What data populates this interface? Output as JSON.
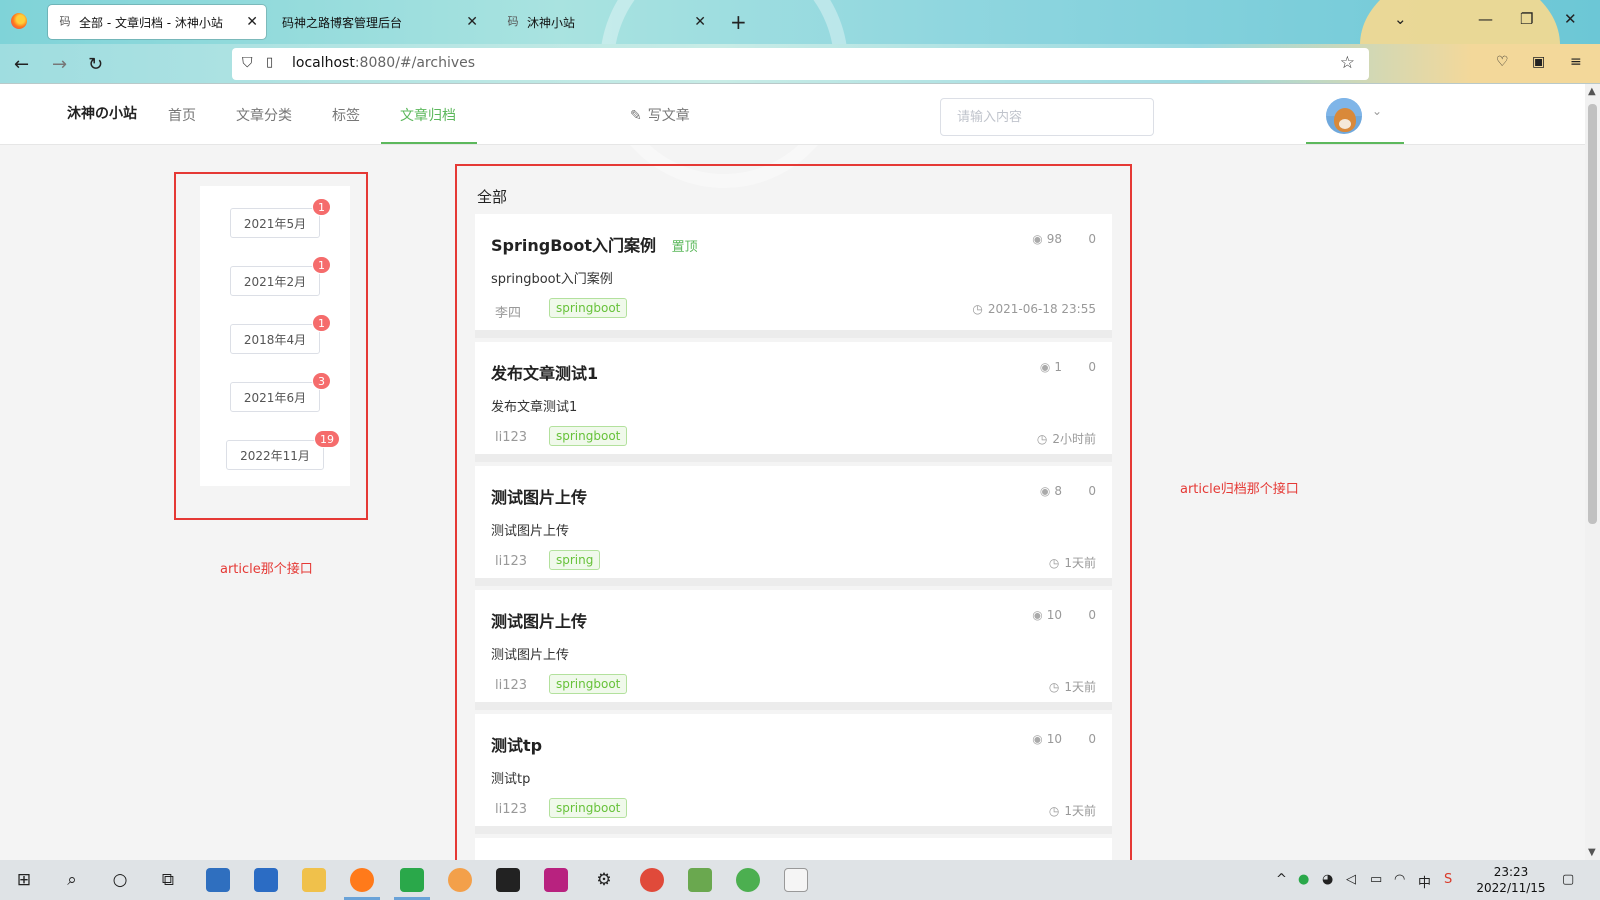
{
  "browser": {
    "tabs": [
      {
        "label": "全部 - 文章归档 - 沐神小站",
        "icon": "码"
      },
      {
        "label": "码神之路博客管理后台",
        "icon": ""
      },
      {
        "label": "沐神小站",
        "icon": "码"
      }
    ],
    "url_host": "localhost",
    "url_rest": ":8080/#/archives"
  },
  "header": {
    "logo": "沐神の小站",
    "nav": [
      "首页",
      "文章分类",
      "标签",
      "文章归档"
    ],
    "active_nav": "文章归档",
    "write_label": "写文章",
    "search_placeholder": "请输入内容",
    "accent_color": "#5cb85c"
  },
  "archives": {
    "items": [
      {
        "label": "2021年5月",
        "count": "1"
      },
      {
        "label": "2021年2月",
        "count": "1"
      },
      {
        "label": "2018年4月",
        "count": "1"
      },
      {
        "label": "2021年6月",
        "count": "3"
      },
      {
        "label": "2022年11月",
        "count": "19"
      }
    ],
    "note": "article那个接口"
  },
  "main": {
    "section_title": "全部",
    "note": "article归档那个接口",
    "articles": [
      {
        "title": "SpringBoot入门案例",
        "top_label": "置顶",
        "views": "98",
        "comments": "0",
        "summary": "springboot入门案例",
        "author": "李四",
        "tag": "springboot",
        "time": "2021-06-18 23:55"
      },
      {
        "title": "发布文章测试1",
        "top_label": "",
        "views": "1",
        "comments": "0",
        "summary": "发布文章测试1",
        "author": "li123",
        "tag": "springboot",
        "time": "2小时前"
      },
      {
        "title": "测试图片上传",
        "top_label": "",
        "views": "8",
        "comments": "0",
        "summary": "测试图片上传",
        "author": "li123",
        "tag": "spring",
        "time": "1天前"
      },
      {
        "title": "测试图片上传",
        "top_label": "",
        "views": "10",
        "comments": "0",
        "summary": "测试图片上传",
        "author": "li123",
        "tag": "springboot",
        "time": "1天前"
      },
      {
        "title": "测试tp",
        "top_label": "",
        "views": "10",
        "comments": "0",
        "summary": "测试tp",
        "author": "li123",
        "tag": "springboot",
        "time": "1天前"
      }
    ]
  },
  "taskbar": {
    "time": "23:23",
    "date": "2022/11/15",
    "ime": "中"
  }
}
